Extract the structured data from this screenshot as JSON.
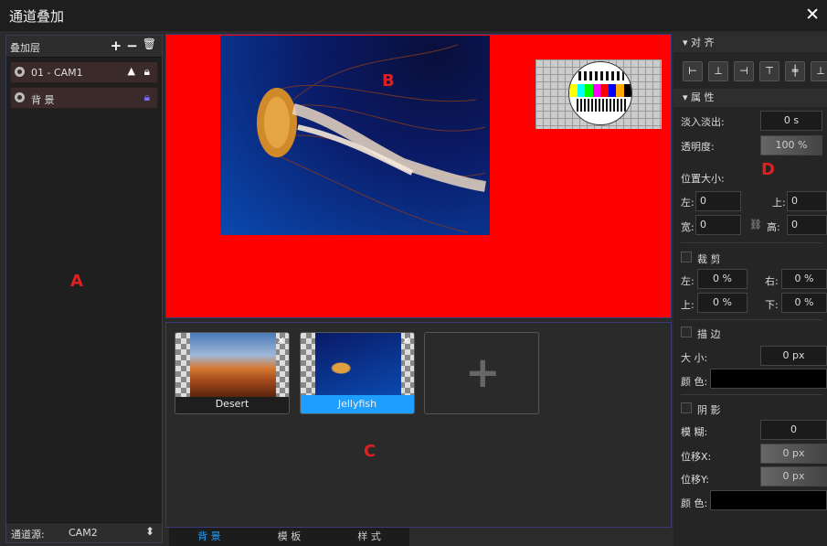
{
  "window": {
    "title": "通道叠加",
    "close": "✕"
  },
  "layers_panel": {
    "header": "叠加层",
    "tools": {
      "add": "+",
      "remove": "−",
      "delete": "🗑"
    },
    "items": [
      {
        "label": "01 - CAM1",
        "lock_color": "#ffffff"
      },
      {
        "label": "背 景",
        "lock_color": "#7a6cff"
      }
    ],
    "annotation": "A",
    "footer": {
      "label": "通道源:",
      "value": "CAM2"
    }
  },
  "preview": {
    "annotation": "B",
    "background": "#ff0000"
  },
  "media": {
    "annotation": "C",
    "items": [
      {
        "caption": "Desert",
        "selected": false
      },
      {
        "caption": "Jellyfish",
        "selected": true
      }
    ],
    "add_label": "+"
  },
  "tabs": [
    {
      "label": "背 景",
      "active": true
    },
    {
      "label": "模 板",
      "active": false
    },
    {
      "label": "样 式",
      "active": false
    }
  ],
  "properties": {
    "annotation": "D",
    "align_section": "▾ 对 齐",
    "align_icons": [
      "align-left-icon",
      "align-center-h-icon",
      "align-right-icon",
      "align-top-icon",
      "align-center-v-icon",
      "align-bottom-icon"
    ],
    "attr_section": "▾ 属 性",
    "fade_label": "淡入淡出:",
    "fade_value": "0 s",
    "opacity_label": "透明度:",
    "opacity_value": "100 %",
    "pos_size_label": "位置大小:",
    "left_label": "左:",
    "left_value": "0",
    "top_label": "上:",
    "top_value": "0",
    "width_label": "宽:",
    "width_value": "0",
    "height_label": "高:",
    "height_value": "0",
    "crop_label": "裁 剪",
    "crop_left_label": "左:",
    "crop_left_value": "0 %",
    "crop_right_label": "右:",
    "crop_right_value": "0 %",
    "crop_top_label": "上:",
    "crop_top_value": "0 %",
    "crop_bottom_label": "下:",
    "crop_bottom_value": "0 %",
    "stroke_label": "描 边",
    "stroke_size_label": "大 小:",
    "stroke_size_value": "0 px",
    "stroke_color_label": "颜 色:",
    "shadow_label": "阴 影",
    "blur_label": "模 糊:",
    "blur_value": "0",
    "offset_x_label": "位移X:",
    "offset_x_value": "0 px",
    "offset_y_label": "位移Y:",
    "offset_y_value": "0 px",
    "shadow_color_label": "颜 色:"
  }
}
